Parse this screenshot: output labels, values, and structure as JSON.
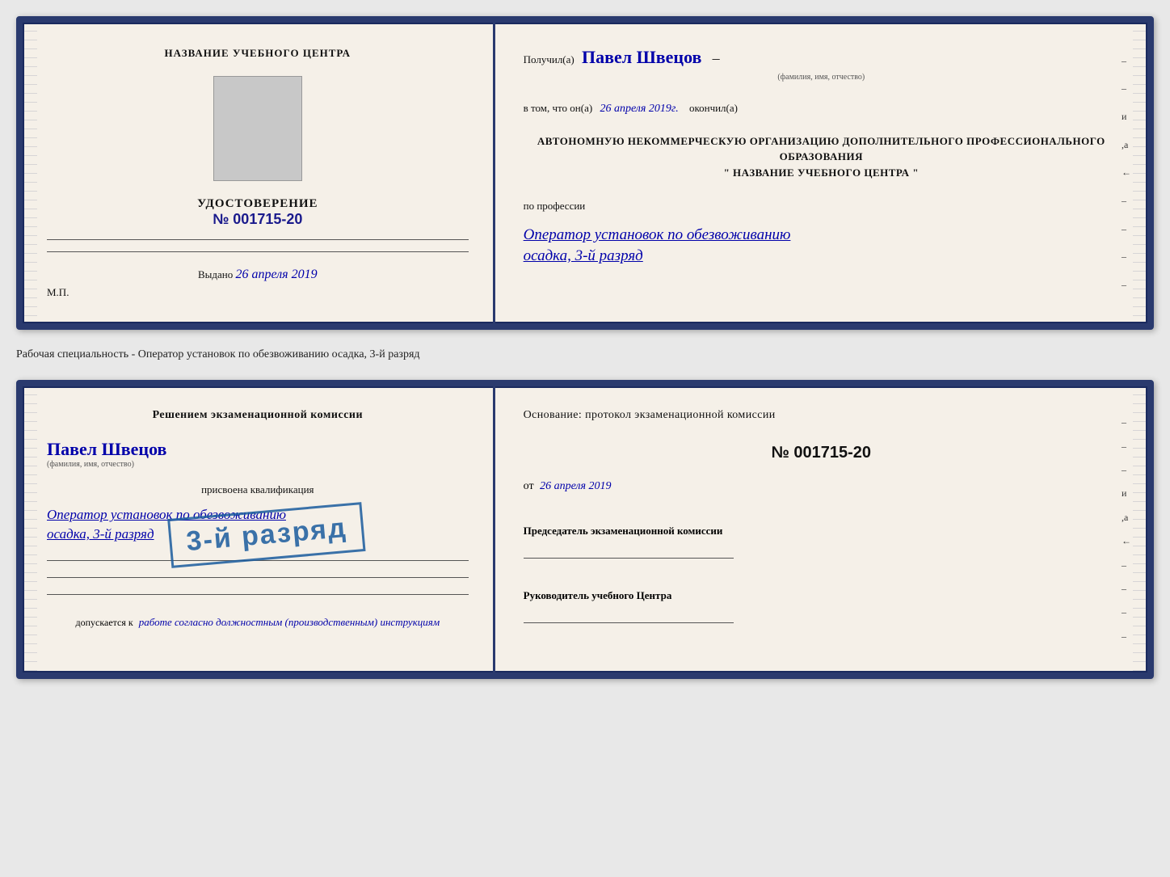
{
  "doc1": {
    "left": {
      "center_title": "НАЗВАНИЕ УЧЕБНОГО ЦЕНТРА",
      "cert_label": "УДОСТОВЕРЕНИЕ",
      "cert_number": "№ 001715-20",
      "issued_label": "Выдано",
      "issued_date": "26 апреля 2019",
      "mp_label": "М.П."
    },
    "right": {
      "received_label": "Получил(а)",
      "recipient_name": "Павел Швецов",
      "fio_hint": "(фамилия, имя, отчество)",
      "dash": "–",
      "in_that_label": "в том, что он(а)",
      "date_handwritten": "26 апреля 2019г.",
      "finished_label": "окончил(а)",
      "org_block": "АВТОНОМНУЮ НЕКОММЕРЧЕСКУЮ ОРГАНИЗАЦИЮ ДОПОЛНИТЕЛЬНОГО ПРОФЕССИОНАЛЬНОГО ОБРАЗОВАНИЯ",
      "org_name_quotes": "\"  НАЗВАНИЕ УЧЕБНОГО ЦЕНТРА  \"",
      "profession_label": "по профессии",
      "profession_line1": "Оператор установок по обезвоживанию",
      "profession_line2": "осадка, 3-й разряд"
    }
  },
  "separator_text": "Рабочая специальность - Оператор установок по обезвоживанию осадка, 3-й разряд",
  "doc2": {
    "left": {
      "decision_label": "Решением экзаменационной комиссии",
      "person_name": "Павел Швецов",
      "fio_hint": "(фамилия, имя, отчество)",
      "assigned_label": "присвоена квалификация",
      "qualification_line1": "Оператор установок по обезвоживанию",
      "qualification_line2": "осадка, 3-й разряд",
      "allowed_label": "допускается к",
      "allowed_text": "работе согласно должностным (производственным) инструкциям"
    },
    "right": {
      "basis_label": "Основание: протокол экзаменационной комиссии",
      "protocol_number": "№  001715-20",
      "date_label": "от",
      "date_value": "26 апреля 2019",
      "chairman_label": "Председатель экзаменационной комиссии",
      "head_label": "Руководитель учебного Центра"
    },
    "stamp_text": "3-й разряд"
  }
}
